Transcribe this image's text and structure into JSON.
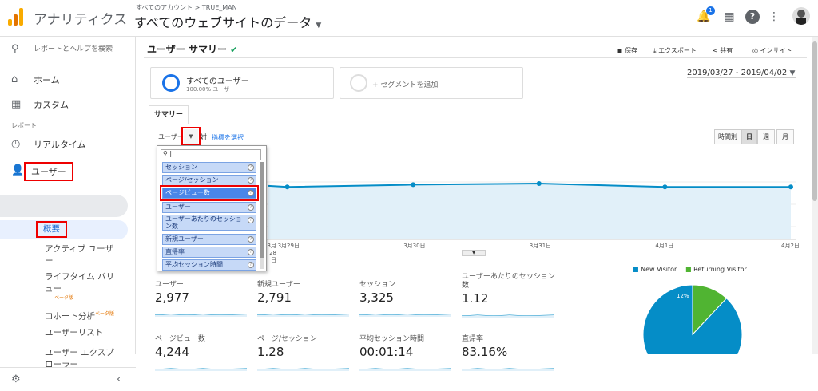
{
  "header": {
    "brand": "アナリティクス",
    "crumb": "すべてのアカウント > TRUE_MAN",
    "view": "すべてのウェブサイトのデータ",
    "badge": "1"
  },
  "sidebar": {
    "search": "レポートとヘルプを検索",
    "home": "ホーム",
    "custom": "カスタム",
    "section": "レポート",
    "realtime": "リアルタイム",
    "audience": "ユーザー",
    "overview": "概要",
    "active": "アクティブ ユーザー",
    "lifetime": "ライフタイム バリュー",
    "lifetime_beta": "ベータ版",
    "cohort": "コホート分析",
    "cohort_beta": "ベータ版",
    "userlist": "ユーザーリスト",
    "explorer": "ユーザー エクスプローラー"
  },
  "page": {
    "title": "ユーザー サマリー",
    "save": "保存",
    "export": "エクスポート",
    "share": "共有",
    "insight": "インサイト",
    "segment": "すべてのユーザー",
    "segment_sub": "100.00% ユーザー",
    "add_segment": "+ セグメントを追加",
    "date_range": "2019/03/27 - 2019/04/02",
    "tab": "サマリー",
    "metric_sel": "ユーザー",
    "vs": "対",
    "choose": "指標を選択",
    "hourly": "時間別",
    "day": "日",
    "week": "週",
    "month": "月"
  },
  "dropdown": {
    "search": "",
    "items": [
      "セッション",
      "ページ/セッション",
      "ページビュー数",
      "ユーザー",
      "ユーザーあたりのセッション数",
      "新規ユーザー",
      "直帰率",
      "平均セッション時間"
    ]
  },
  "chart_data": {
    "type": "line",
    "categories": [
      "3月28日",
      "3月29日",
      "3月30日",
      "3月31日",
      "4月1日",
      "4月2日"
    ],
    "values": [
      null,
      460,
      480,
      490,
      460,
      460
    ]
  },
  "metrics": [
    {
      "label": "ユーザー",
      "value": "2,977"
    },
    {
      "label": "新規ユーザー",
      "value": "2,791"
    },
    {
      "label": "セッション",
      "value": "3,325"
    },
    {
      "label": "ユーザーあたりのセッション数",
      "value": "1.12"
    },
    {
      "label": "ページビュー数",
      "value": "4,244"
    },
    {
      "label": "ページ/セッション",
      "value": "1.28"
    },
    {
      "label": "平均セッション時間",
      "value": "00:01:14"
    },
    {
      "label": "直帰率",
      "value": "83.16%"
    }
  ],
  "pie": {
    "new_label": "New Visitor",
    "ret_label": "Returning Visitor",
    "ret_pct": "12%",
    "new_color": "#058dc7",
    "ret_color": "#50b432",
    "ret_fraction": 0.12
  }
}
